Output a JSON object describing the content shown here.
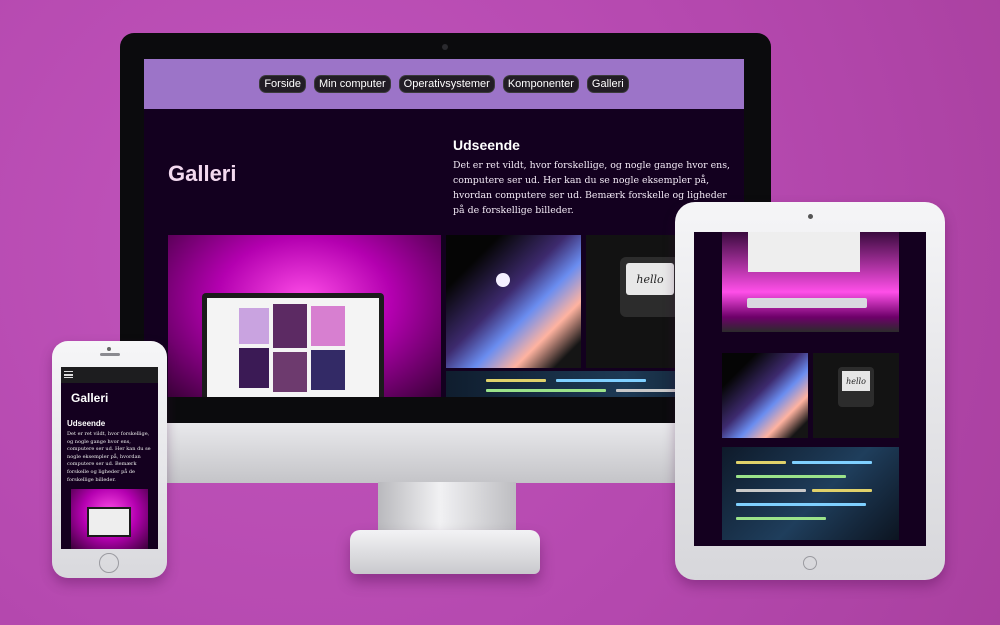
{
  "site": {
    "nav": [
      "Forside",
      "Min computer",
      "Operativsystemer",
      "Komponenter",
      "Galleri"
    ],
    "title": "Galleri",
    "subtitle": "Udseende",
    "body": "Det er ret vildt, hvor forskellige, og nogle gange hvor ens, computere ser ud. Her kan du se nogle eksempler på, hvordan computere ser ud. Bemærk forskelle og ligheder på de forskellige billeder."
  },
  "images": {
    "hello_text": "hello"
  },
  "colors": {
    "background": "#b84bb2",
    "nav_bar": "#9c74c8",
    "page_bg": "#13001f",
    "title": "#f3d9ef"
  },
  "icons": [
    "apple-logo-icon",
    "hamburger-menu-icon"
  ]
}
